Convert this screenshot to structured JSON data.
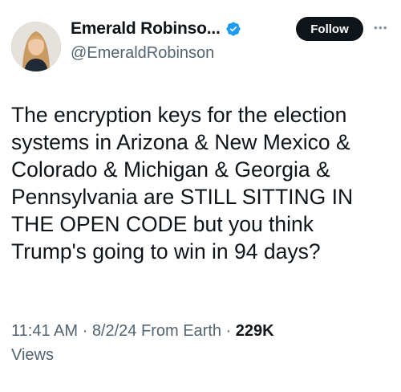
{
  "author": {
    "display_name": "Emerald Robinso...",
    "handle": "@EmeraldRobinson",
    "verified_icon": "verified-badge-icon",
    "avatar_icon": "avatar-photo"
  },
  "follow_label": "Follow",
  "more_icon": "more-icon",
  "tweet_text": "The encryption keys for the election\nsystems in Arizona & New Mexico &\nColorado & Michigan & Georgia &\nPennsylvania are STILL SITTING IN\nTHE OPEN CODE but you think\nTrump's going to win in 94 days?",
  "meta": {
    "time": "11:41 AM",
    "separator1": " · ",
    "date": "8/2/24",
    "source": " From Earth",
    "separator2": " · ",
    "views_count": "229K",
    "views_label": "Views"
  },
  "colors": {
    "text_primary": "#0f1419",
    "text_secondary": "#536471",
    "verified_blue": "#1d9bf0",
    "follow_bg": "#0f1419"
  }
}
